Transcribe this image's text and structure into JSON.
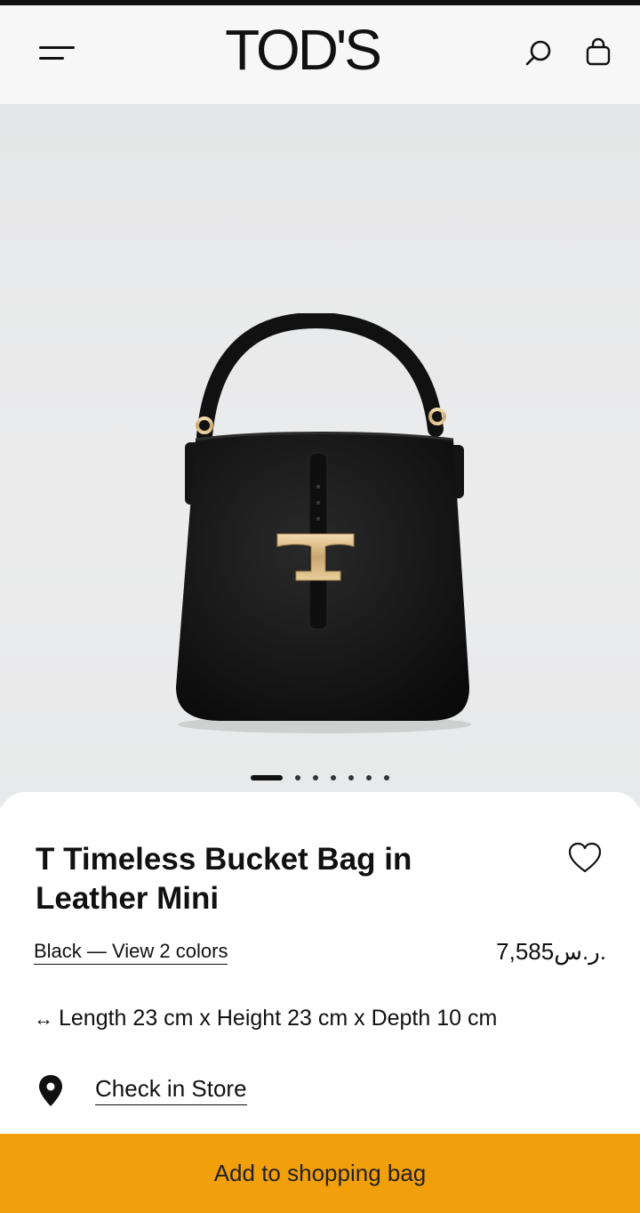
{
  "header": {
    "brand": "TOD'S",
    "icons": {
      "menu": "hamburger-menu-icon",
      "search": "search-icon",
      "bag": "shopping-bag-icon"
    }
  },
  "gallery": {
    "total_images": 7,
    "active_index": 0
  },
  "product": {
    "title": "T Timeless Bucket Bag in Leather Mini",
    "color_link": "Black — View 2 colors",
    "price": "7,585ر.س.",
    "dimensions": "Length 23 cm x Height 23 cm x Depth 10 cm",
    "dimensions_icon": "↔",
    "store_link": "Check in Store"
  },
  "cta": {
    "label": "Add to shopping bag"
  },
  "colors": {
    "accent": "#f29f0c",
    "text": "#111111",
    "header_bg": "#f7f7f7",
    "hero_bg": "#e9eaeb"
  }
}
